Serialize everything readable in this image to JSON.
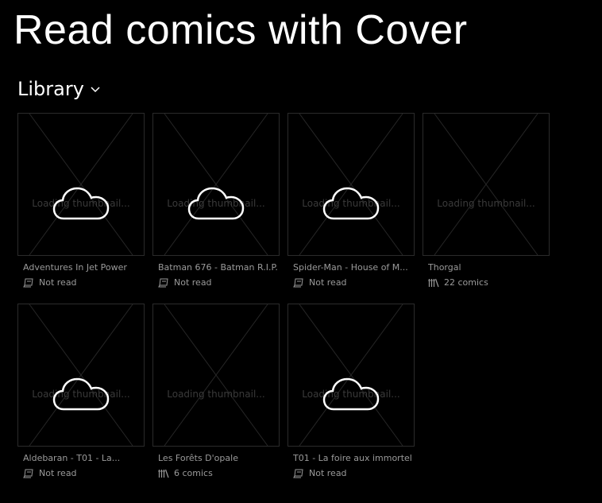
{
  "app": {
    "title": "Read comics with Cover"
  },
  "library": {
    "header": "Library",
    "loading_text": "Loading thumbnail...",
    "items": [
      {
        "title": "Adventures In Jet Power",
        "status": "Not read",
        "status_icon": "book-icon",
        "type": "comic",
        "cloud": true
      },
      {
        "title": "Batman 676 - Batman R.I.P....",
        "status": "Not read",
        "status_icon": "book-icon",
        "type": "comic",
        "cloud": true
      },
      {
        "title": "Spider-Man - House of M...",
        "status": "Not read",
        "status_icon": "book-icon",
        "type": "comic",
        "cloud": true
      },
      {
        "title": "Thorgal",
        "status": "22 comics",
        "status_icon": "collection-icon",
        "type": "collection",
        "cloud": false
      },
      {
        "title": "Aldebaran - T01 - La...",
        "status": "Not read",
        "status_icon": "book-icon",
        "type": "comic",
        "cloud": true
      },
      {
        "title": "Les Forêts D'opale",
        "status": "6 comics",
        "status_icon": "collection-icon",
        "type": "collection",
        "cloud": false
      },
      {
        "title": "T01 - La foire aux immortels",
        "status": "Not read",
        "status_icon": "book-icon",
        "type": "comic",
        "cloud": true
      }
    ]
  },
  "colors": {
    "background": "#000000",
    "text": "#ffffff",
    "muted": "#9a9a9a",
    "placeholder_line": "#2b2b2b"
  }
}
